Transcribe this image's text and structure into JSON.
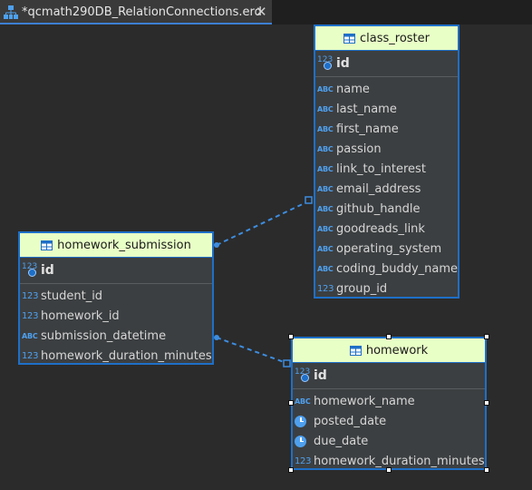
{
  "tab": {
    "title": "*qcmath290DB_RelationConnections.erd",
    "close": "✕"
  },
  "entities": {
    "class_roster": {
      "title": "class_roster",
      "pk": {
        "name": "id",
        "type": "123"
      },
      "columns": [
        {
          "name": "name",
          "type": "ABC"
        },
        {
          "name": "last_name",
          "type": "ABC"
        },
        {
          "name": "first_name",
          "type": "ABC"
        },
        {
          "name": "passion",
          "type": "ABC"
        },
        {
          "name": "link_to_interest",
          "type": "ABC"
        },
        {
          "name": "email_address",
          "type": "ABC"
        },
        {
          "name": "github_handle",
          "type": "ABC"
        },
        {
          "name": "goodreads_link",
          "type": "ABC"
        },
        {
          "name": "operating_system",
          "type": "ABC"
        },
        {
          "name": "coding_buddy_name",
          "type": "ABC"
        },
        {
          "name": "group_id",
          "type": "123"
        }
      ]
    },
    "homework_submission": {
      "title": "homework_submission",
      "pk": {
        "name": "id",
        "type": "123"
      },
      "columns": [
        {
          "name": "student_id",
          "type": "123"
        },
        {
          "name": "homework_id",
          "type": "123"
        },
        {
          "name": "submission_datetime",
          "type": "ABC"
        },
        {
          "name": "homework_duration_minutes",
          "type": "123"
        }
      ]
    },
    "homework": {
      "title": "homework",
      "pk": {
        "name": "id",
        "type": "123"
      },
      "columns": [
        {
          "name": "homework_name",
          "type": "ABC"
        },
        {
          "name": "posted_date",
          "type": "clock"
        },
        {
          "name": "due_date",
          "type": "clock"
        },
        {
          "name": "homework_duration_minutes",
          "type": "123"
        }
      ]
    }
  },
  "colors": {
    "accent": "#1e6fc7",
    "header_fill": "#e8ffc6",
    "type_icon": "#4ea0ef",
    "canvas": "#2b2b2b"
  }
}
